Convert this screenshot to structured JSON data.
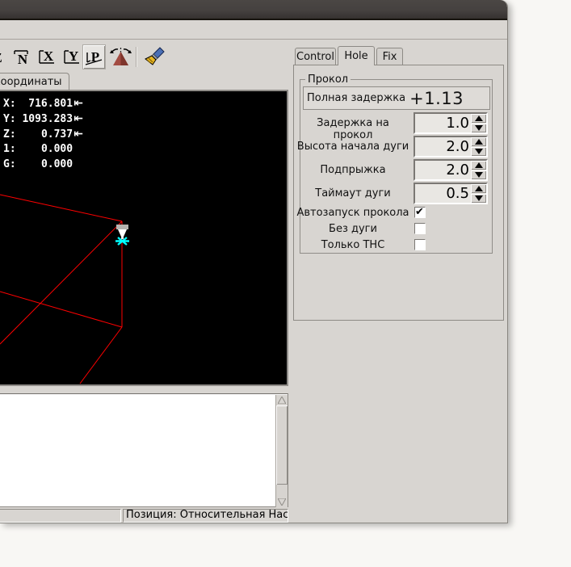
{
  "colors": {
    "wireframe_red": "#ff0000",
    "tool_marker_cyan": "#00ffff",
    "canvas_black": "#000000",
    "titlebar_dark": "#44403d",
    "window_gray": "#d8d5d1",
    "desktop_white": "#f8f7f4"
  },
  "toolbar": {
    "buttons": [
      {
        "id": "view-z",
        "letter": "Z"
      },
      {
        "id": "view-z-rotated",
        "letter": "N"
      },
      {
        "id": "view-x",
        "letter": "X"
      },
      {
        "id": "view-y",
        "letter": "Y"
      },
      {
        "id": "view-p",
        "letter": "P",
        "active": true
      }
    ]
  },
  "preview": {
    "tab_label": "Координаты",
    "dro_rows": [
      {
        "axis": "X:",
        "value": "716.801",
        "arrow": "⇤"
      },
      {
        "axis": "Y:",
        "value": "1093.283",
        "arrow": "⇤"
      },
      {
        "axis": "Z:",
        "value": "0.737",
        "arrow": "⇤"
      },
      {
        "axis": "1:",
        "value": "0.000",
        "arrow": ""
      },
      {
        "axis": "G:",
        "value": "0.000",
        "arrow": ""
      }
    ]
  },
  "statusbar": {
    "position_text": "Позиция: Относительная Настоящая"
  },
  "right_panel": {
    "tabs": [
      {
        "label": "Control"
      },
      {
        "label": "Hole"
      },
      {
        "label": "Fix"
      }
    ],
    "active_tab": "Hole",
    "group_title": "Прокол",
    "total_delay": {
      "label": "Полная задержка",
      "value": "+1.13"
    },
    "spinners": [
      {
        "label": "Задержка на прокол",
        "value": "1.0"
      },
      {
        "label": "Высота начала дуги",
        "value": "2.0"
      },
      {
        "label": "Подпрыжка",
        "value": "2.0"
      },
      {
        "label": "Таймаут дуги",
        "value": "0.5"
      }
    ],
    "checkboxes": [
      {
        "label": "Автозапуск прокола",
        "checked": true,
        "mark": "✔"
      },
      {
        "label": "Без дуги",
        "checked": false,
        "mark": ""
      },
      {
        "label": "Только THC",
        "checked": false,
        "mark": ""
      }
    ]
  }
}
